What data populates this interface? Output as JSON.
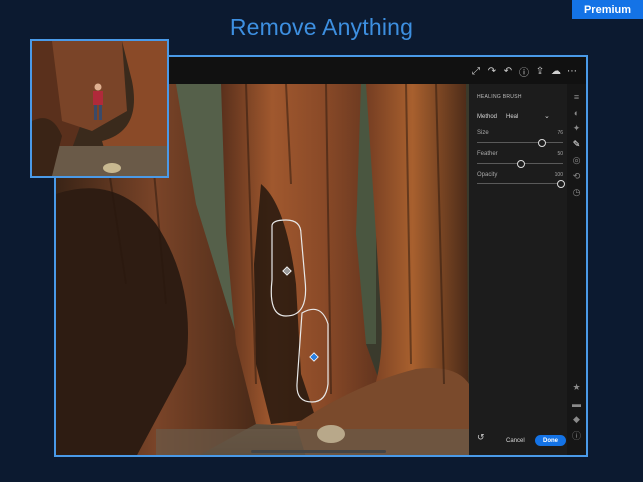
{
  "badge": {
    "label": "Premium"
  },
  "headline": "Remove Anything",
  "toolbar": {
    "icons": [
      "expand-icon",
      "redo-icon",
      "undo-icon",
      "help-icon",
      "share-icon",
      "cloud-icon",
      "more-icon"
    ]
  },
  "panel": {
    "title": "HEALING BRUSH",
    "method": {
      "label": "Method",
      "value": "Heal"
    },
    "sliders": [
      {
        "label": "Size",
        "value": "76",
        "level": 0.76
      },
      {
        "label": "Feather",
        "value": "50",
        "level": 0.5
      },
      {
        "label": "Opacity",
        "value": "100",
        "level": 1.0
      }
    ],
    "cancel": "Cancel",
    "done": "Done"
  },
  "colors": {
    "background": "#0c1a30",
    "accent": "#1473e6",
    "frame": "#4a9ae8",
    "headline": "#3d8fe0",
    "panel": "#1c1c1c"
  }
}
